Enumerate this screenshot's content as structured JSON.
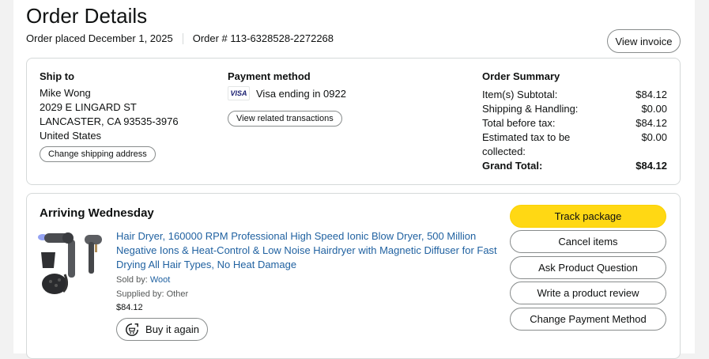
{
  "header": {
    "title": "Order Details",
    "order_placed": "Order placed December 1, 2025",
    "order_number": "Order # 113-6328528-2272268",
    "view_invoice": "View invoice"
  },
  "ship_to": {
    "heading": "Ship to",
    "lines": [
      "Mike Wong",
      "2029 E LINGARD ST",
      "LANCASTER, CA 93535-3976",
      "United States"
    ],
    "change_button": "Change shipping address"
  },
  "payment": {
    "heading": "Payment method",
    "card_brand": "VISA",
    "card_text": "Visa ending in 0922",
    "view_transactions": "View related transactions"
  },
  "summary": {
    "heading": "Order Summary",
    "rows": [
      {
        "label": "Item(s) Subtotal:",
        "value": "$84.12"
      },
      {
        "label": "Shipping & Handling:",
        "value": "$0.00"
      },
      {
        "label": "Total before tax:",
        "value": "$84.12"
      },
      {
        "label": "Estimated tax to be collected:",
        "value": "$0.00"
      }
    ],
    "grand_total_label": "Grand Total:",
    "grand_total_value": "$84.12"
  },
  "shipment": {
    "status": "Arriving Wednesday",
    "product_title": "Hair Dryer, 160000 RPM Professional High Speed Ionic Blow Dryer, 500 Million Negative Ions & Heat-Control & Low Noise Hairdryer with Magnetic Diffuser for Fast Drying All Hair Types, No Heat Damage",
    "sold_by_label": "Sold by: ",
    "sold_by": "Woot",
    "supplied_by": "Supplied by: Other",
    "price": "$84.12",
    "buy_again": "Buy it again",
    "actions": {
      "track": "Track package",
      "cancel": "Cancel items",
      "ask": "Ask Product Question",
      "review": "Write a product review",
      "change_payment": "Change Payment Method"
    }
  },
  "colors": {
    "link": "#2162a1",
    "track_button": "#ffd814",
    "border": "#d5d9d9"
  }
}
